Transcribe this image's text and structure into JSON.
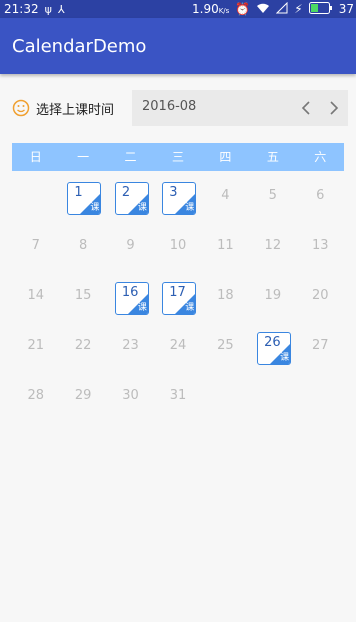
{
  "status": {
    "time": "21:32",
    "net_speed": "1.90",
    "net_unit": "K/s",
    "battery": "37"
  },
  "app": {
    "title": "CalendarDemo"
  },
  "picker": {
    "label": "选择上课时间",
    "month": "2016-08"
  },
  "weekdays": [
    "日",
    "一",
    "二",
    "三",
    "四",
    "五",
    "六"
  ],
  "class_tag": "课",
  "accent_color": "#3a86e0",
  "header_color": "#8ec4ff",
  "app_bar_color": "#3a54c4",
  "weeks": [
    [
      {
        "day": ""
      },
      {
        "day": "1",
        "marked": true
      },
      {
        "day": "2",
        "marked": true
      },
      {
        "day": "3",
        "marked": true
      },
      {
        "day": "4"
      },
      {
        "day": "5"
      },
      {
        "day": "6"
      }
    ],
    [
      {
        "day": "7"
      },
      {
        "day": "8"
      },
      {
        "day": "9"
      },
      {
        "day": "10"
      },
      {
        "day": "11"
      },
      {
        "day": "12"
      },
      {
        "day": "13"
      }
    ],
    [
      {
        "day": "14"
      },
      {
        "day": "15"
      },
      {
        "day": "16",
        "marked": true
      },
      {
        "day": "17",
        "marked": true
      },
      {
        "day": "18"
      },
      {
        "day": "19"
      },
      {
        "day": "20"
      }
    ],
    [
      {
        "day": "21"
      },
      {
        "day": "22"
      },
      {
        "day": "23"
      },
      {
        "day": "24"
      },
      {
        "day": "25"
      },
      {
        "day": "26",
        "marked": true
      },
      {
        "day": "27"
      }
    ],
    [
      {
        "day": "28"
      },
      {
        "day": "29"
      },
      {
        "day": "30"
      },
      {
        "day": "31"
      },
      {
        "day": ""
      },
      {
        "day": ""
      },
      {
        "day": ""
      }
    ]
  ]
}
